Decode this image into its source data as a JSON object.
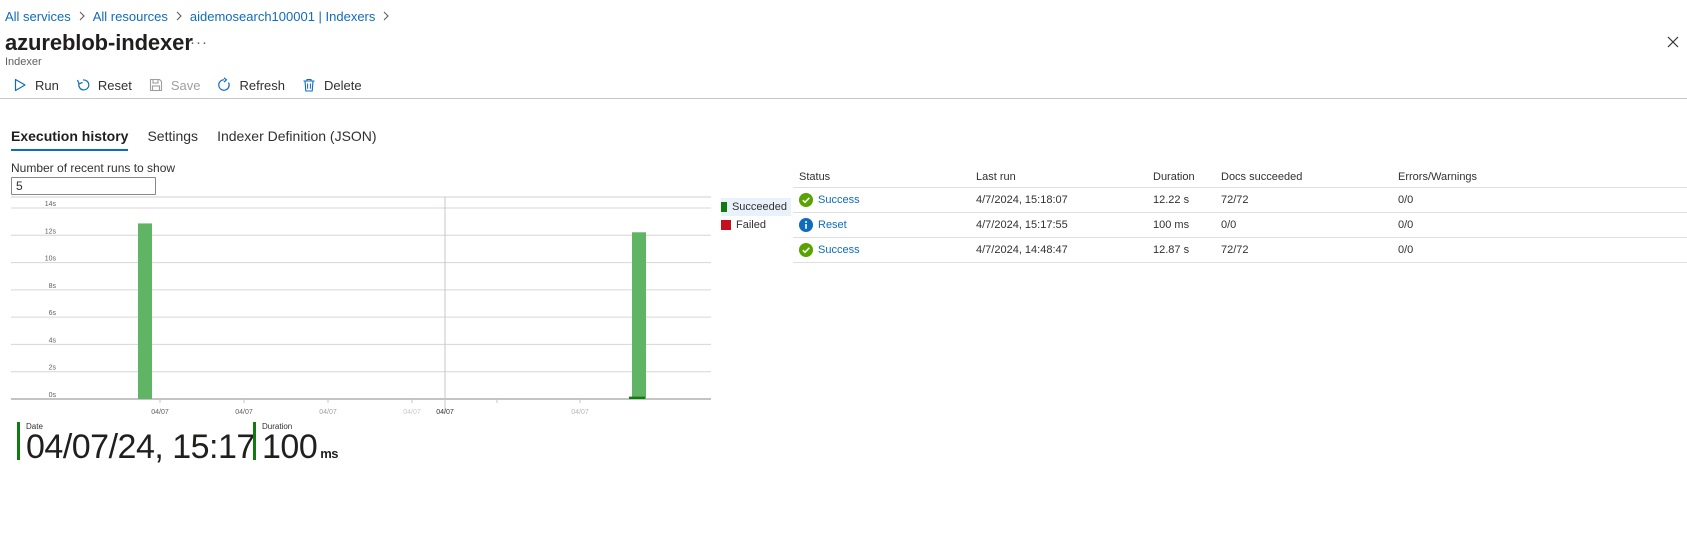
{
  "breadcrumb": [
    {
      "label": "All services"
    },
    {
      "label": "All resources"
    },
    {
      "label": "aidemosearch100001 | Indexers"
    }
  ],
  "header": {
    "title": "azureblob-indexer",
    "subtitle": "Indexer",
    "more": "···"
  },
  "toolbar": {
    "run": "Run",
    "reset": "Reset",
    "save": "Save",
    "refresh": "Refresh",
    "delete": "Delete"
  },
  "tabs": [
    {
      "label": "Execution history",
      "active": true
    },
    {
      "label": "Settings",
      "active": false
    },
    {
      "label": "Indexer Definition (JSON)",
      "active": false
    }
  ],
  "runs": {
    "label": "Number of recent runs to show",
    "value": "5"
  },
  "chart_data": {
    "type": "bar",
    "y_ticks": [
      "14s",
      "12s",
      "10s",
      "8s",
      "6s",
      "4s",
      "2s",
      "0s"
    ],
    "ylim": [
      0,
      14
    ],
    "x_ticks": [
      "04/07",
      "04/07",
      "04/07",
      "04/07",
      "04/07",
      "04/07"
    ],
    "legend_placement": "right",
    "series": [
      {
        "name": "Succeeded",
        "color": "#107c10",
        "values": [
          12.87,
          12.22
        ]
      },
      {
        "name": "Failed",
        "color": "#c50f1f",
        "values": []
      }
    ],
    "reset_run_value": 0.1
  },
  "metrics": [
    {
      "label": "Date",
      "value": "04/07/24, 15:17",
      "unit": ""
    },
    {
      "label": "Duration",
      "value": "100",
      "unit": "ms"
    }
  ],
  "table": {
    "headers": {
      "status": "Status",
      "last_run": "Last run",
      "duration": "Duration",
      "docs": "Docs succeeded",
      "errors": "Errors/Warnings"
    },
    "rows": [
      {
        "status": "Success",
        "status_icon": "check-circle-icon",
        "last_run": "4/7/2024, 15:18:07",
        "duration": "12.22 s",
        "docs": "72/72",
        "errors": "0/0"
      },
      {
        "status": "Reset",
        "status_icon": "info-circle-icon",
        "last_run": "4/7/2024, 15:17:55",
        "duration": "100 ms",
        "docs": "0/0",
        "errors": "0/0"
      },
      {
        "status": "Success",
        "status_icon": "check-circle-icon",
        "last_run": "4/7/2024, 14:48:47",
        "duration": "12.87 s",
        "docs": "72/72",
        "errors": "0/0"
      }
    ]
  },
  "colors": {
    "accent": "#0f6cbd",
    "success": "#107c10",
    "failed": "#c50f1f",
    "bar": "#5fb563",
    "info": "#0f6cbd"
  }
}
